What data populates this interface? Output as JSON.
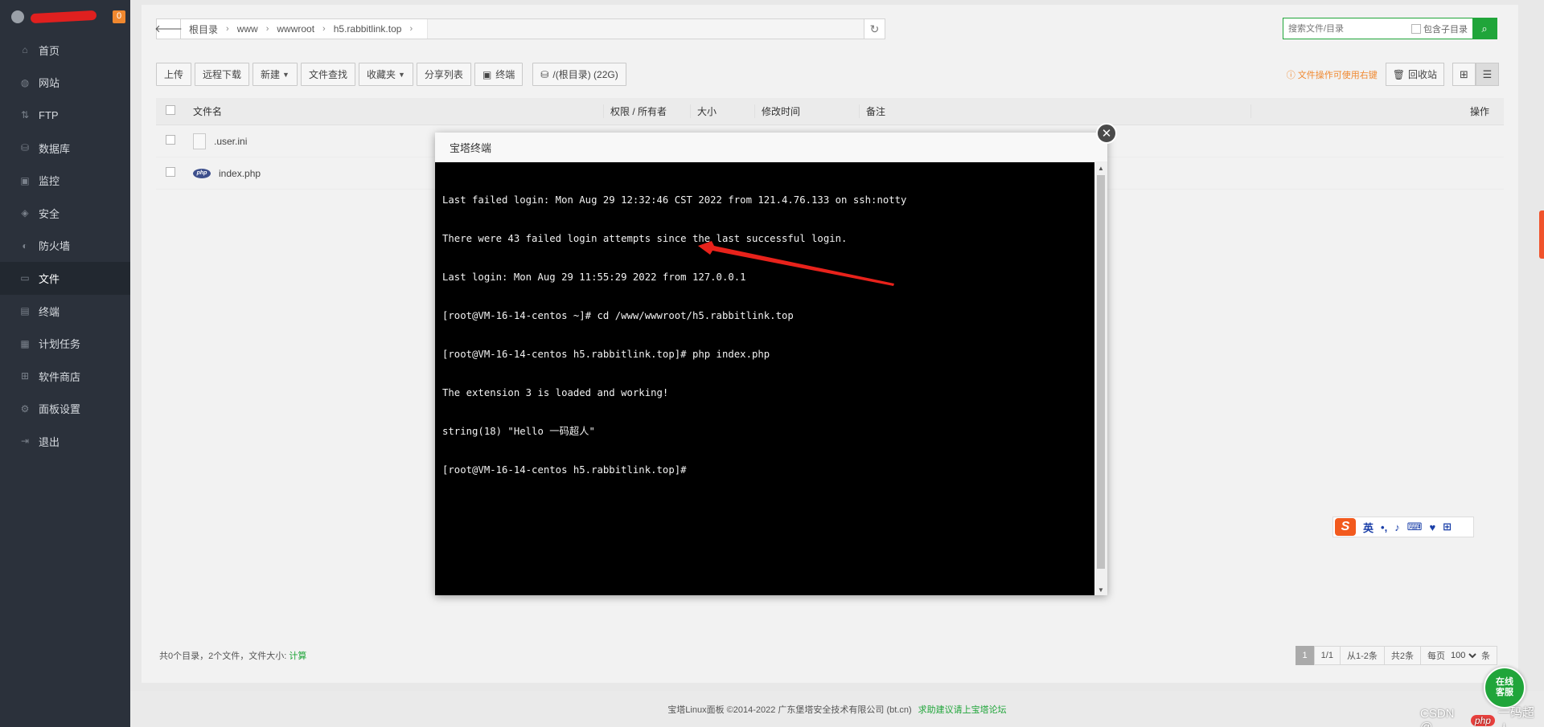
{
  "sidebar": {
    "badge": "0",
    "items": [
      {
        "label": "首页",
        "icon": "home-icon",
        "glyph": "⌂"
      },
      {
        "label": "网站",
        "icon": "globe-icon",
        "glyph": "◍"
      },
      {
        "label": "FTP",
        "icon": "ftp-icon",
        "glyph": "⇅"
      },
      {
        "label": "数据库",
        "icon": "database-icon",
        "glyph": "⛁"
      },
      {
        "label": "监控",
        "icon": "monitor-icon",
        "glyph": "▣"
      },
      {
        "label": "安全",
        "icon": "shield-icon",
        "glyph": "◈"
      },
      {
        "label": "防火墙",
        "icon": "firewall-icon",
        "glyph": "◐"
      },
      {
        "label": "文件",
        "icon": "folder-icon",
        "glyph": "▭"
      },
      {
        "label": "终端",
        "icon": "terminal-icon",
        "glyph": "▤"
      },
      {
        "label": "计划任务",
        "icon": "calendar-icon",
        "glyph": "▦"
      },
      {
        "label": "软件商店",
        "icon": "apps-icon",
        "glyph": "⊞"
      },
      {
        "label": "面板设置",
        "icon": "gear-icon",
        "glyph": "⚙"
      },
      {
        "label": "退出",
        "icon": "logout-icon",
        "glyph": "⇥"
      }
    ],
    "active_index": 7
  },
  "path": {
    "crumbs": [
      "根目录",
      "www",
      "wwwroot",
      "h5.rabbitlink.top"
    ]
  },
  "search": {
    "placeholder": "搜索文件/目录",
    "include_sub": "包含子目录"
  },
  "toolbar": {
    "upload": "上传",
    "remote_download": "远程下载",
    "new": "新建",
    "file_search": "文件查找",
    "favorites": "收藏夹",
    "share_list": "分享列表",
    "terminal": "终端",
    "disk": "/(根目录) (22G)"
  },
  "tools_right": {
    "hint": "文件操作可使用右键",
    "recycle": "回收站"
  },
  "table": {
    "headers": {
      "name": "文件名",
      "perm": "权限 / 所有者",
      "size": "大小",
      "mtime": "修改时间",
      "note": "备注",
      "op": "操作"
    },
    "rows": [
      {
        "name": ".user.ini",
        "type": "doc"
      },
      {
        "name": "index.php",
        "type": "php"
      }
    ]
  },
  "footer": {
    "summary": "共0个目录，2个文件，文件大小:",
    "calc": "计算",
    "pager": {
      "current": "1",
      "pages": "1/1",
      "range": "从1-2条",
      "total": "共2条",
      "per_page_label": "每页",
      "per_page": "100",
      "unit": "条"
    }
  },
  "copyright": {
    "text": "宝塔Linux面板 ©2014-2022 广东堡塔安全技术有限公司 (bt.cn)",
    "help": "求助建议请上宝塔论坛"
  },
  "modal": {
    "title": "宝塔终端",
    "lines": [
      "Last failed login: Mon Aug 29 12:32:46 CST 2022 from 121.4.76.133 on ssh:notty",
      "There were 43 failed login attempts since the last successful login.",
      "Last login: Mon Aug 29 11:55:29 2022 from 127.0.0.1",
      "[root@VM-16-14-centos ~]# cd /www/wwwroot/h5.rabbitlink.top",
      "[root@VM-16-14-centos h5.rabbitlink.top]# php index.php",
      "The extension 3 is loaded and working!",
      "string(18) \"Hello 一码超人\"",
      "[root@VM-16-14-centos h5.rabbitlink.top]#"
    ]
  },
  "ime": {
    "logo": "S",
    "mode": "英"
  },
  "online": {
    "line1": "在线",
    "line2": "客服"
  },
  "watermark": {
    "prefix": "CSDN @",
    "badge": "php",
    "suffix": "一码超人"
  },
  "colors": {
    "accent": "#20a53a",
    "sidebar_bg": "#2b313b",
    "warning": "#f0882f",
    "annotation_arrow": "#e8221b"
  }
}
